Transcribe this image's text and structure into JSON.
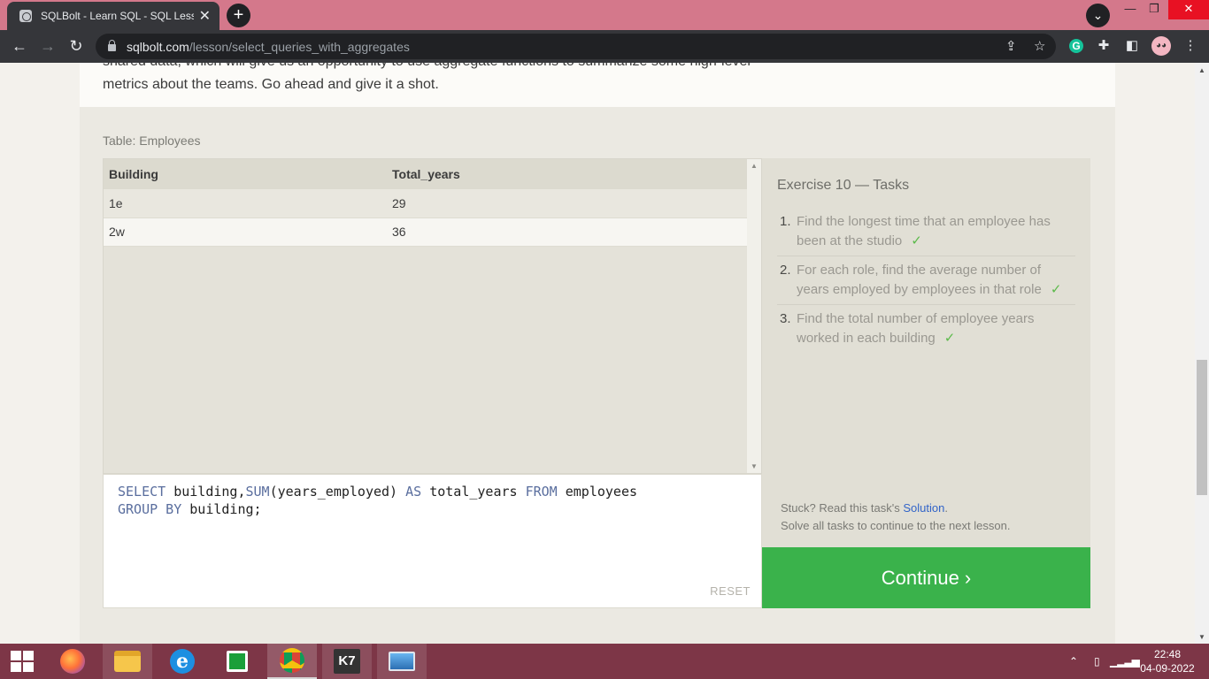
{
  "browser": {
    "tab_title": "SQLBolt - Learn SQL - SQL Lesson",
    "tab_close": "✕",
    "new_tab": "+",
    "url_host": "sqlbolt.com",
    "url_path": "/lesson/select_queries_with_aggregates",
    "window": {
      "minimize": "—",
      "restore": "❐",
      "close": "✕"
    },
    "extensions": {
      "grammarly": "G"
    }
  },
  "lesson": {
    "intro_clipped": "shared data, which will give us an opportunity to use aggregate functions to summarize some high-level",
    "intro_text": "metrics about the teams. Go ahead and give it a shot."
  },
  "results": {
    "table_label": "Table: Employees",
    "columns": [
      "Building",
      "Total_years"
    ],
    "rows": [
      [
        "1e",
        "29"
      ],
      [
        "2w",
        "36"
      ]
    ]
  },
  "editor": {
    "line1": {
      "kw1": "SELECT",
      "t1": " building,",
      "kw2": "SUM",
      "t2": "(years_employed) ",
      "kw3": "AS",
      "t3": " total_years ",
      "kw4": "FROM",
      "t4": " employees"
    },
    "line2": {
      "kw1": "GROUP BY",
      "t1": " building;"
    },
    "reset_label": "RESET"
  },
  "tasks": {
    "heading": "Exercise 10 — Tasks",
    "check": "✓",
    "items": [
      {
        "num": "1.",
        "text": "Find the longest time that an employee has been at the studio"
      },
      {
        "num": "2.",
        "text": "For each role, find the average number of years employed by employees in that role"
      },
      {
        "num": "3.",
        "text": "Find the total number of employee years worked in each building"
      }
    ],
    "help_prefix": "Stuck? Read this task's ",
    "help_link": "Solution",
    "help_suffix": ".",
    "help_line2": "Solve all tasks to continue to the next lesson.",
    "continue_label": "Continue ›"
  },
  "taskbar": {
    "apps": [
      "firefox",
      "internet-explorer",
      "file-explorer",
      "microsoft-store",
      "chrome",
      "k7-antivirus",
      "photos"
    ],
    "time": "22:48",
    "date": "04-09-2022"
  },
  "colors": {
    "accent_green": "#3ab24b",
    "keyword_blue": "#5a6e9e",
    "link_blue": "#3264c8",
    "tab_strip": "#d4788b"
  }
}
